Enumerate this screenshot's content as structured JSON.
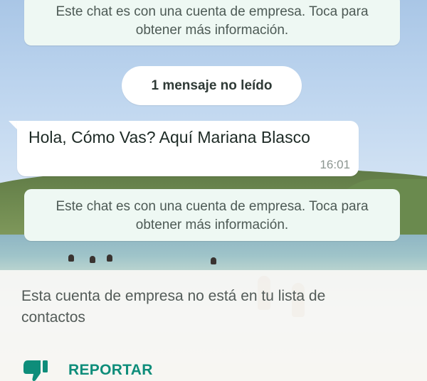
{
  "chat": {
    "business_notice_top": "Este chat es con una cuenta de empresa. Toca para obtener más información.",
    "unread_banner": "1 mensaje no leído",
    "message": {
      "text": "Hola, Cómo Vas? Aquí Mariana Blasco",
      "time": "16:01"
    },
    "business_notice_bottom": "Este chat es con una cuenta de empresa. Toca para obtener más información."
  },
  "notice_panel": {
    "text": "Esta cuenta de empresa no está en tu lista de contactos",
    "report_label": "REPORTAR",
    "report_icon": "thumbs-down-icon"
  },
  "colors": {
    "accent": "#0e8d7a",
    "system_bubble": "#eef8f3",
    "message_bubble": "#ffffff"
  }
}
